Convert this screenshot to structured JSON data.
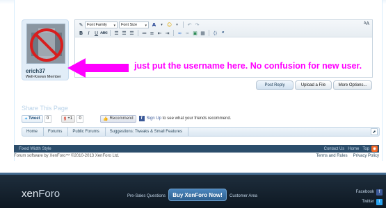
{
  "user": {
    "username": "erich37",
    "title": "Well-Known Member"
  },
  "editor": {
    "font_family": "Font Family",
    "font_size": "Font Size",
    "row1_buttons": [
      "format-icon",
      "text-color-icon",
      "smilies-icon",
      "undo-icon",
      "redo-icon"
    ],
    "row2_buttons": [
      "B",
      "I",
      "U",
      "ABC"
    ],
    "toggle_label": "A"
  },
  "annotation": {
    "text": "just put the username here. No confusion for new user.",
    "color": "#ff00ff"
  },
  "actions": {
    "post_reply": "Post Reply",
    "upload": "Upload a File",
    "more": "More Options..."
  },
  "share": {
    "title": "Share This Page",
    "tweet_label": "Tweet",
    "tweet_count": "0",
    "gplus_label": "+1",
    "gplus_count": "0",
    "recommend_label": "Recommend",
    "signup_link": "Sign Up",
    "signup_rest": " to see what your friends recommend."
  },
  "breadcrumb": {
    "items": [
      "Home",
      "Forums",
      "Public Forums",
      "Suggestions: Tweaks & Small Features"
    ]
  },
  "footer": {
    "style_label": "Fixed Width Style",
    "links": [
      "Contact Us",
      "Home",
      "Top"
    ],
    "copyright": "Forum software by XenForo™ ©2010-2013 XenForo Ltd.",
    "legal": [
      "Terms and Rules",
      "Privacy Policy"
    ]
  },
  "xenforo": {
    "logo_xen": "xen",
    "logo_foro": "Foro",
    "presales": "Pre-Sales Questions",
    "buy": "Buy XenForo Now!",
    "customer": "Customer Area",
    "facebook": "Facebook",
    "twitter": "Twitter"
  },
  "colors": {
    "accent": "#2b4d6b",
    "annotation": "#ff00ff"
  }
}
